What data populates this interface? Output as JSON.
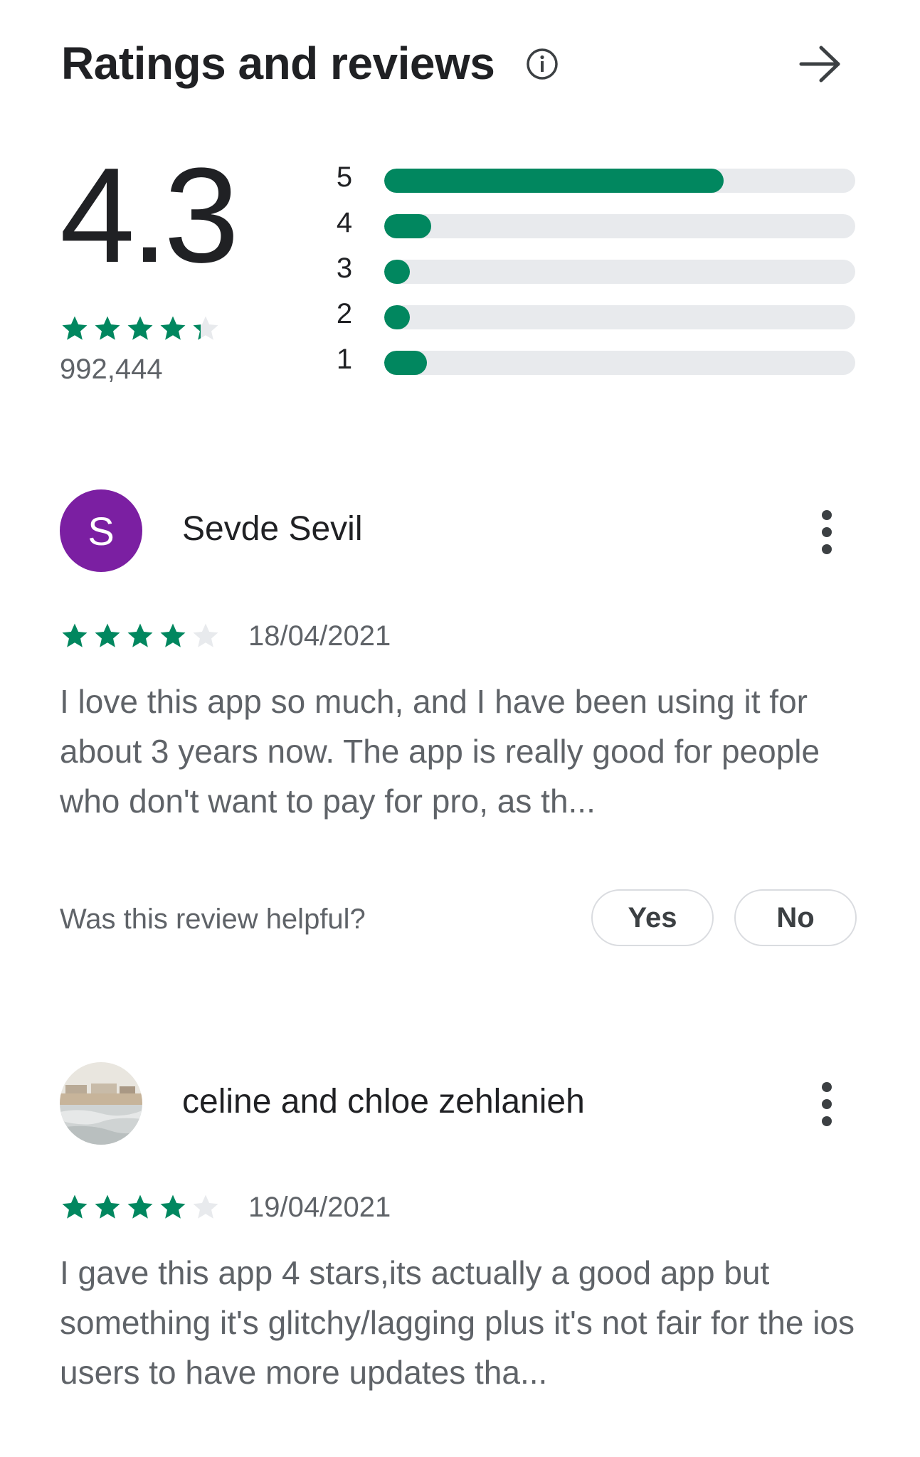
{
  "header": {
    "title": "Ratings and reviews",
    "info_icon": "info-icon",
    "arrow_icon": "arrow-right-icon"
  },
  "summary": {
    "score": "4.3",
    "score_value": 4.3,
    "total_count": "992,444",
    "distribution": [
      {
        "label": "5",
        "fraction": 0.72
      },
      {
        "label": "4",
        "fraction": 0.1
      },
      {
        "label": "3",
        "fraction": 0.055
      },
      {
        "label": "2",
        "fraction": 0.055
      },
      {
        "label": "1",
        "fraction": 0.09
      }
    ]
  },
  "reviews": [
    {
      "avatar_letter": "S",
      "name": "Sevde Sevil",
      "rating": 4,
      "date": "18/04/2021",
      "text": "I love this app so much, and I have been using it for about 3 years now. The app is really good for people who don't want to pay for pro, as th...",
      "helpful_question": "Was this review helpful?",
      "yes_label": "Yes",
      "no_label": "No"
    },
    {
      "avatar_letter": "",
      "name": "celine and chloe zehlanieh",
      "rating": 4,
      "date": "19/04/2021",
      "text": "I gave this app 4 stars,its actually a good app but something it's glitchy/lagging plus it's not fair for the ios users to have more updates tha..."
    }
  ],
  "colors": {
    "accent_green": "#01875f",
    "track_gray": "#e8eaed",
    "avatar_purple": "#7b1fa2",
    "star_empty": "#e8eaed"
  }
}
